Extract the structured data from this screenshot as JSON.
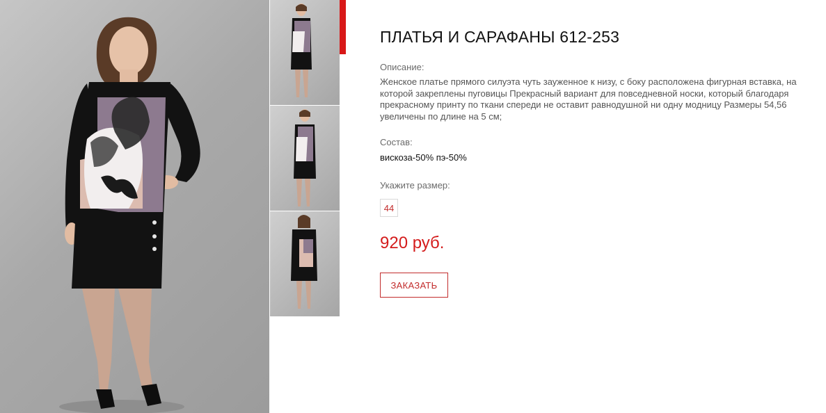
{
  "product": {
    "title": "ПЛАТЬЯ И САРАФАНЫ 612-253",
    "description_label": "Описание:",
    "description": "Женское платье прямого силуэта чуть зауженное к низу, с боку расположена фигурная вставка, на которой закреплены пуговицы Прекрасный вариант для повседневной носки, который благодаря прекрасному принту по ткани спереди не оставит равнодушной ни одну модницу Размеры 54,56 увеличены по длине на 5 см;",
    "composition_label": "Состав:",
    "composition": "вискоза-50% пэ-50%",
    "size_label": "Укажите размер:",
    "sizes": [
      "44"
    ],
    "price": "920 руб.",
    "order_button": "ЗАКАЗАТЬ"
  },
  "colors": {
    "accent": "#d41c1c",
    "dress_black": "#121212",
    "dress_lilac": "#8d7a8f",
    "dress_pink": "#dcbcb0",
    "backdrop": "#a9a9a9"
  }
}
